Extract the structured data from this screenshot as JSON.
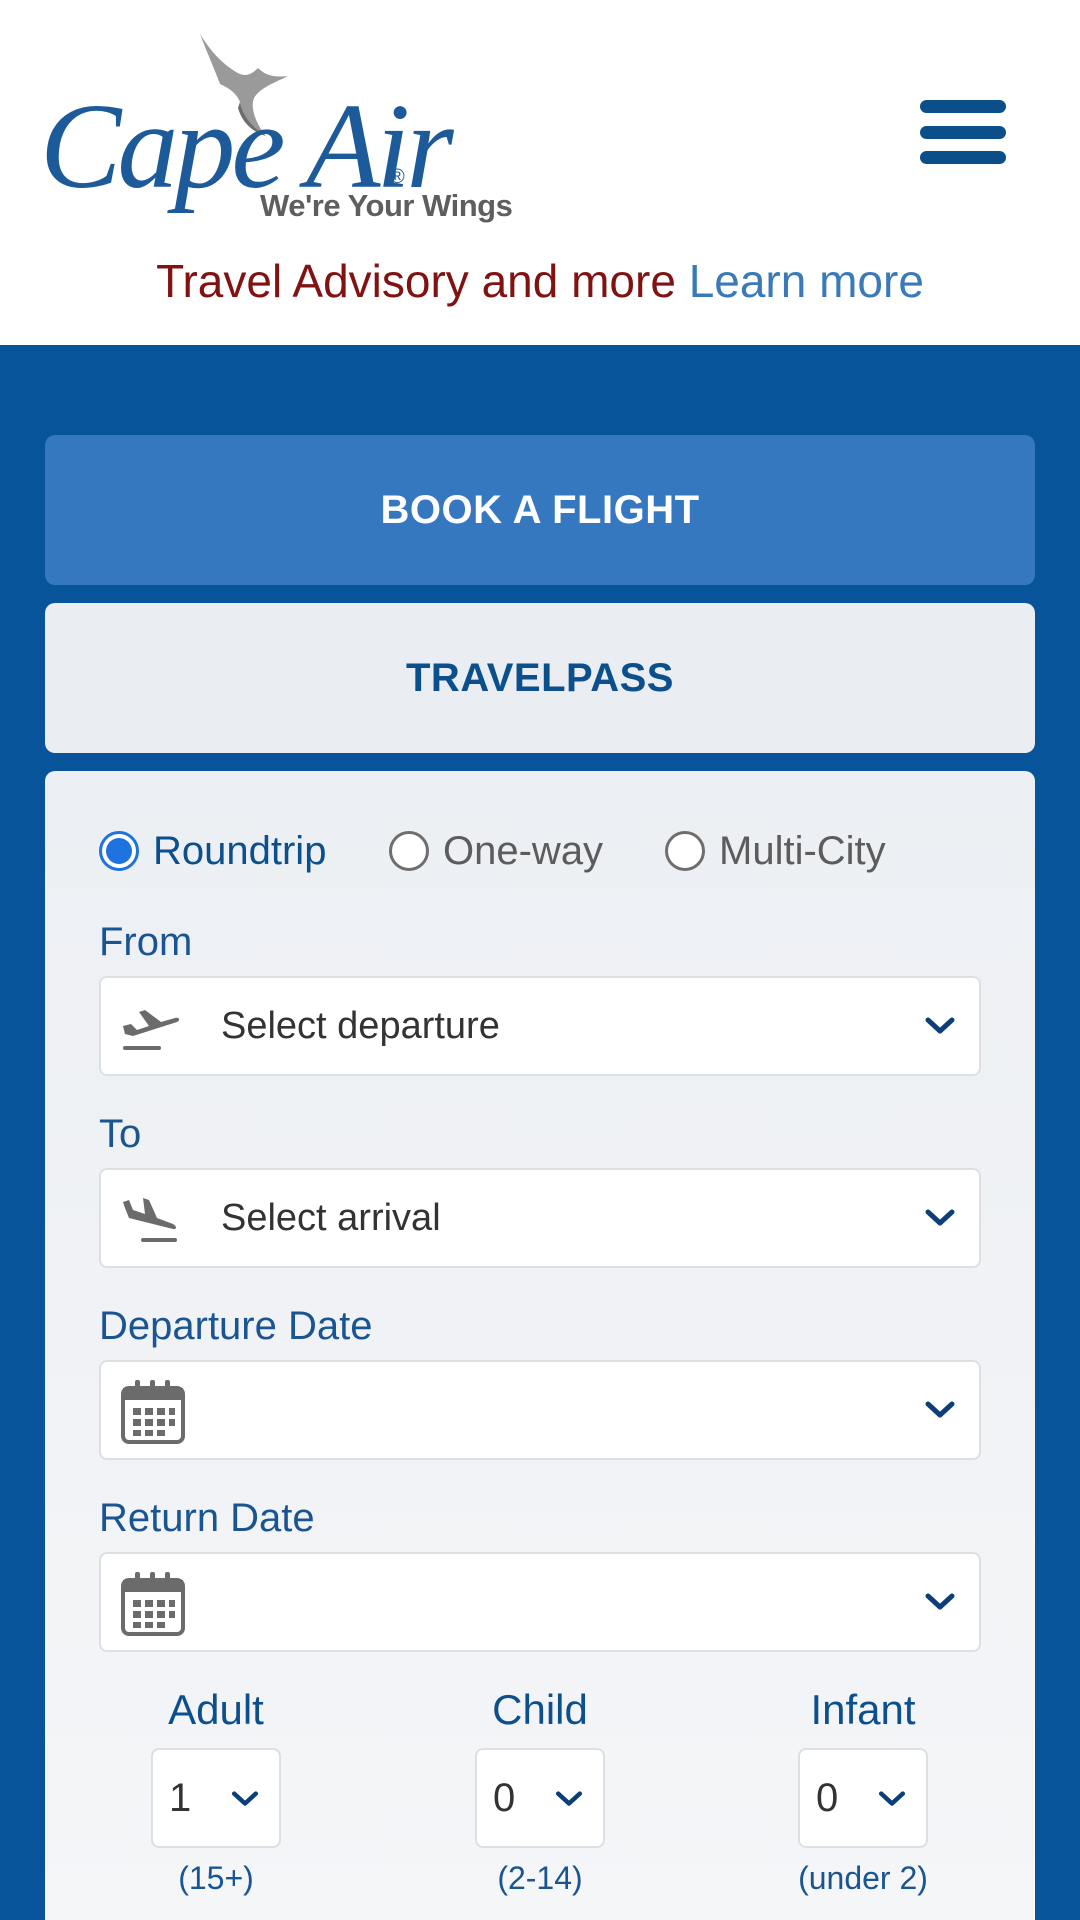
{
  "header": {
    "logo_text": "Cape Air",
    "logo_tagline": "We're Your Wings",
    "advisory_text": "Travel Advisory and more",
    "advisory_link": "Learn more"
  },
  "tabs": {
    "book": "BOOK A FLIGHT",
    "travelpass": "TRAVELPASS"
  },
  "trip_type": {
    "options": [
      "Roundtrip",
      "One-way",
      "Multi-City"
    ],
    "selected": "Roundtrip"
  },
  "fields": {
    "from_label": "From",
    "from_value": "Select departure",
    "to_label": "To",
    "to_value": "Select arrival",
    "departure_label": "Departure Date",
    "departure_value": "",
    "return_label": "Return Date",
    "return_value": ""
  },
  "passengers": {
    "adult": {
      "label": "Adult",
      "value": "1",
      "note": "(15+)"
    },
    "child": {
      "label": "Child",
      "value": "0",
      "note": "(2-14)"
    },
    "infant": {
      "label": "Infant",
      "value": "0",
      "note": "(under 2)"
    }
  },
  "colors": {
    "brand_blue": "#08549a",
    "active_tab": "#3578bf",
    "advisory_red": "#801212",
    "link_blue": "#3a7ab8",
    "radio_selected": "#1f73e0"
  },
  "icons": {
    "menu": "hamburger-menu-icon",
    "from": "plane-takeoff-icon",
    "to": "plane-landing-icon",
    "date": "calendar-icon",
    "dropdown": "chevron-down-icon"
  }
}
